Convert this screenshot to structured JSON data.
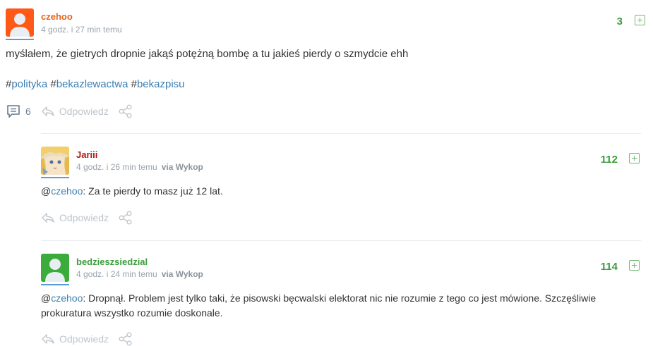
{
  "main_post": {
    "author": "czehoo",
    "time": "4 godz. i 27 min temu",
    "score": "3",
    "text": "myślałem, że gietrych dropnie jakąś potężną bombę a tu jakieś pierdy o szmydcie ehh",
    "tags": [
      "polityka",
      "bekazlewactwa",
      "bekazpisu"
    ],
    "comment_count": "6",
    "reply_label": "Odpowiedz"
  },
  "comments": [
    {
      "author": "Jariii",
      "time": "4 godz. i 26 min temu",
      "via": "via Wykop",
      "score": "112",
      "mention": "czehoo",
      "text": ": Za te pierdy to masz już 12 lat.",
      "reply_label": "Odpowiedz"
    },
    {
      "author": "bedzieszsiedzial",
      "time": "4 godz. i 24 min temu",
      "via": "via Wykop",
      "score": "114",
      "mention": "czehoo",
      "text": ": Dropnął. Problem jest tylko taki, że pisowski bęcwalski elektorat nic nie rozumie z tego co jest mówione. Szczęśliwie prokuratura wszystko rozumie doskonale.",
      "reply_label": "Odpowiedz"
    }
  ],
  "colors": {
    "author_orange": "#e8641b",
    "author_red": "#b11616",
    "author_green": "#3c9d3c",
    "tag_blue": "#3c7fb1",
    "score_green": "#3c9d3c"
  }
}
